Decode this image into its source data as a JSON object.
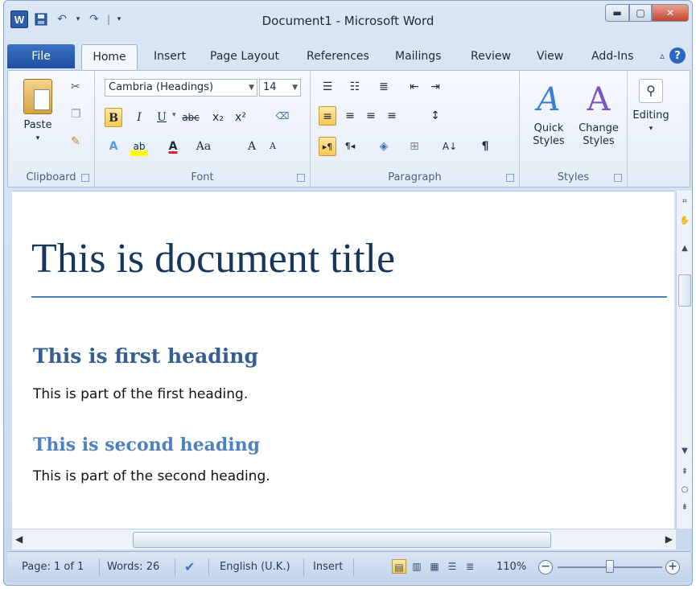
{
  "window": {
    "title": "Document1 - Microsoft Word"
  },
  "qat": {
    "logo": "W",
    "save": "▪",
    "undo": "↶",
    "redo": "↷",
    "sep": "|"
  },
  "tabs": {
    "file": "File",
    "home": "Home",
    "insert": "Insert",
    "page_layout": "Page Layout",
    "references": "References",
    "mailings": "Mailings",
    "review": "Review",
    "view": "View",
    "addins": "Add-Ins",
    "help": "?"
  },
  "ribbon": {
    "clipboard": {
      "label": "Clipboard",
      "paste": "Paste"
    },
    "font": {
      "label": "Font",
      "family": "Cambria (Headings)",
      "size": "14",
      "bold": "B",
      "italic": "I",
      "underline": "U",
      "strike": "abc",
      "subscript": "x₂",
      "superscript": "x²",
      "text_effects": "A",
      "highlight": "ab",
      "font_color": "A",
      "change_case": "Aa",
      "grow": "A",
      "shrink": "A",
      "clear": "A"
    },
    "paragraph": {
      "label": "Paragraph",
      "pilcrow": "¶",
      "sort": "A↓"
    },
    "styles": {
      "label": "Styles",
      "quick": "Quick Styles",
      "change": "Change Styles"
    },
    "editing": {
      "label": "Editing"
    }
  },
  "document": {
    "title": "This is document title",
    "heading1": "This is first heading",
    "para1": "This is part of the first heading.",
    "heading2": "This is second heading",
    "para2": "This is part of the second heading."
  },
  "status": {
    "page": "Page: 1 of 1",
    "words": "Words: 26",
    "language": "English (U.K.)",
    "mode": "Insert",
    "zoom": "110%",
    "zoom_level_percent": 110
  },
  "colors": {
    "title": "#17365d",
    "heading1": "#365f91",
    "heading2": "#4f81bd",
    "rule": "#4f81bd",
    "file_tab": "#2a62b8",
    "active_button": "#f7c955"
  }
}
